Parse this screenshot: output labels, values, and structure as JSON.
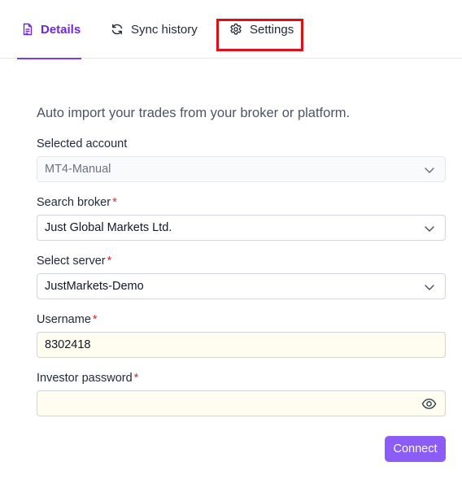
{
  "tabs": {
    "details": "Details",
    "sync_history": "Sync history",
    "settings": "Settings"
  },
  "intro": "Auto import your trades from your broker or platform.",
  "form": {
    "selected_account": {
      "label": "Selected account",
      "value": "MT4-Manual",
      "required": false
    },
    "search_broker": {
      "label": "Search broker",
      "value": "Just Global Markets Ltd.",
      "required": true
    },
    "select_server": {
      "label": "Select server",
      "value": "JustMarkets-Demo",
      "required": true
    },
    "username": {
      "label": "Username",
      "value": "8302418",
      "required": true
    },
    "investor_password": {
      "label": "Investor password",
      "value": "",
      "required": true
    },
    "required_mark": "*"
  },
  "connect_button": "Connect",
  "colors": {
    "accent": "#7c3aed",
    "button": "#8b5cf6",
    "required": "#dc2626",
    "highlight": "#e10d17"
  },
  "icons": {
    "details": "document-icon",
    "sync_history": "refresh-icon",
    "settings": "gear-icon",
    "dropdown": "chevron-down-icon",
    "password_toggle": "eye-icon"
  }
}
